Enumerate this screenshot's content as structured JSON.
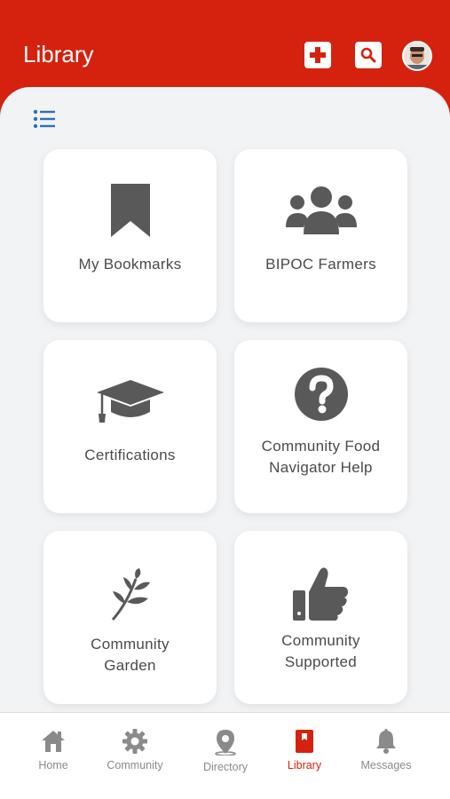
{
  "header": {
    "title": "Library"
  },
  "cards": [
    {
      "label": "My Bookmarks"
    },
    {
      "label": "BIPOC Farmers"
    },
    {
      "label": "Certifications"
    },
    {
      "label": "Community Food\nNavigator Help"
    },
    {
      "label": "Community\nGarden"
    },
    {
      "label": "Community\nSupported"
    }
  ],
  "tabs": [
    {
      "label": "Home"
    },
    {
      "label": "Community"
    },
    {
      "label": "Directory"
    },
    {
      "label": "Library"
    },
    {
      "label": "Messages"
    }
  ],
  "colors": {
    "accent": "#d4220e",
    "icon": "#595959",
    "inactive_tab": "#8a8a8a"
  }
}
